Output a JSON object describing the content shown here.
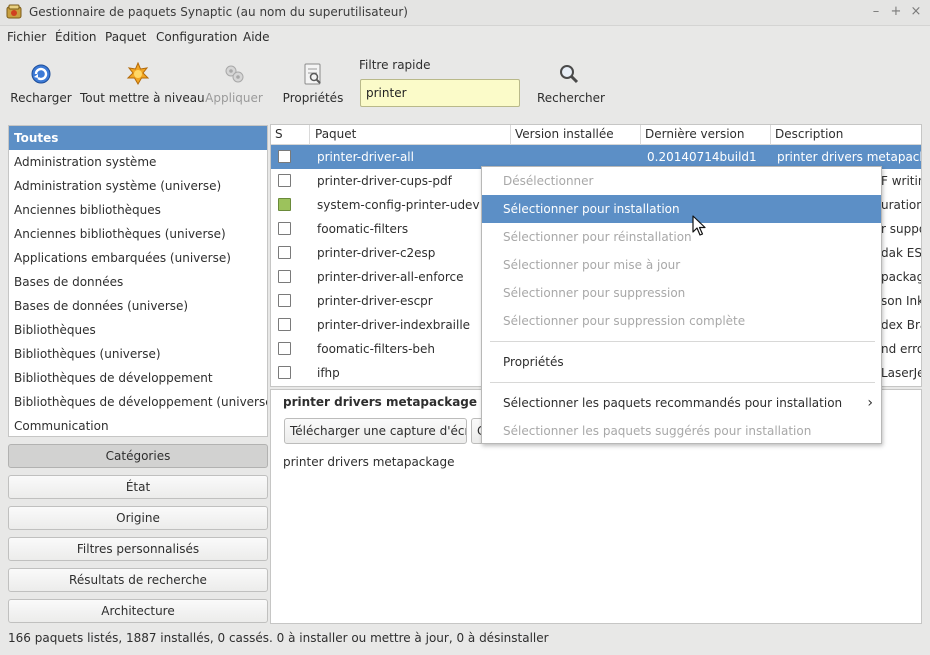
{
  "window": {
    "title": "Gestionnaire de paquets Synaptic  (au nom du superutilisateur)",
    "controls": [
      "–",
      "+",
      "×"
    ]
  },
  "menubar": [
    "Fichier",
    "Édition",
    "Paquet",
    "Configuration",
    "Aide"
  ],
  "toolbar": {
    "reload": "Recharger",
    "upgrade_all": "Tout mettre à niveau",
    "apply": "Appliquer",
    "properties": "Propriétés",
    "search": "Rechercher",
    "filter_label": "Filtre rapide",
    "filter_value": "printer"
  },
  "categories": [
    "Toutes",
    "Administration système",
    "Administration système (universe)",
    "Anciennes bibliothèques",
    "Anciennes bibliothèques (universe)",
    "Applications embarquées (universe)",
    "Bases de données",
    "Bases de données (universe)",
    "Bibliothèques",
    "Bibliothèques (universe)",
    "Bibliothèques de développement",
    "Bibliothèques de développement (universe)",
    "Communication"
  ],
  "side_buttons": [
    "Catégories",
    "État",
    "Origine",
    "Filtres personnalisés",
    "Résultats de recherche",
    "Architecture"
  ],
  "table": {
    "headers": [
      "S",
      "Paquet",
      "Version installée",
      "Dernière version",
      "Description"
    ],
    "rows": [
      {
        "name": "printer-driver-all",
        "installed": "",
        "latest": "0.20140714build1",
        "desc": "printer drivers metapackage"
      },
      {
        "name": "printer-driver-cups-pdf",
        "installed": "",
        "latest": "",
        "desc": "F writin"
      },
      {
        "name": "system-config-printer-udev",
        "installed": "",
        "latest": "",
        "desc": "uration t"
      },
      {
        "name": "foomatic-filters",
        "installed": "",
        "latest": "",
        "desc": "r suppo"
      },
      {
        "name": "printer-driver-c2esp",
        "installed": "",
        "latest": "",
        "desc": "dak ESP"
      },
      {
        "name": "printer-driver-all-enforce",
        "installed": "",
        "latest": "",
        "desc": "packag"
      },
      {
        "name": "printer-driver-escpr",
        "installed": "",
        "latest": "",
        "desc": "son Inkj"
      },
      {
        "name": "printer-driver-indexbraille",
        "installed": "",
        "latest": "",
        "desc": "dex Brai"
      },
      {
        "name": "foomatic-filters-beh",
        "installed": "",
        "latest": "",
        "desc": "nd erro"
      },
      {
        "name": "ifhp",
        "installed": "",
        "latest": "",
        "desc": "LaserJe"
      }
    ]
  },
  "detail": {
    "title": "printer drivers metapackage",
    "screenshot_button": "Télécharger une capture d'écran",
    "second_button": "C",
    "description": "printer drivers metapackage"
  },
  "context_menu": [
    "Désélectionner",
    "Sélectionner pour installation",
    "Sélectionner pour réinstallation",
    "Sélectionner pour mise à jour",
    "Sélectionner pour suppression",
    "Sélectionner pour suppression complète",
    "Propriétés",
    "Sélectionner les paquets recommandés pour installation",
    "Sélectionner les paquets suggérés pour installation"
  ],
  "status": "166 paquets listés, 1887 installés, 0 cassés. 0 à installer ou mettre à jour, 0 à désinstaller",
  "colors": {
    "selection": "#5c8fc6",
    "installed": "#9cc25c",
    "filter_bg": "#fbfbc9"
  }
}
